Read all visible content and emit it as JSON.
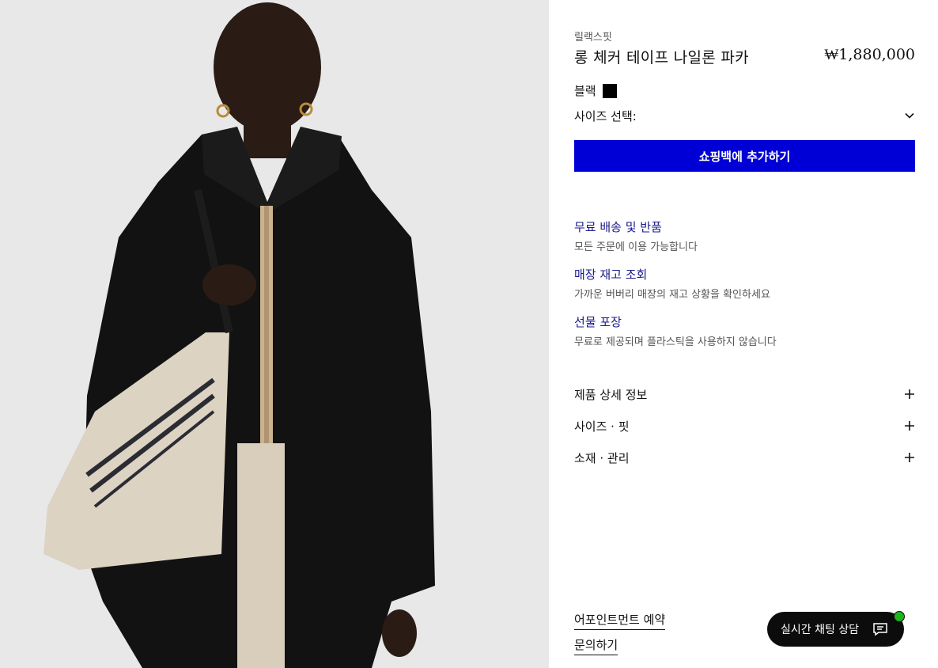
{
  "product": {
    "fit": "릴랙스핏",
    "title": "롱 체커 테이프 나일론 파카",
    "price": "₩1,880,000",
    "color_label": "블랙",
    "color_swatch": "#000000",
    "size_label": "사이즈 선택:",
    "add_to_bag": "쇼핑백에 추가하기",
    "accent_color": "#0000d6"
  },
  "services": [
    {
      "title": "무료 배송 및 반품",
      "desc": "모든 주문에 이용 가능합니다"
    },
    {
      "title": "매장 재고 조회",
      "desc": "가까운 버버리 매장의 재고 상황을 확인하세요"
    },
    {
      "title": "선물 포장",
      "desc": "무료로 제공되며 플라스틱을 사용하지 않습니다"
    }
  ],
  "accordion": [
    {
      "label": "제품 상세 정보",
      "icon": "plus-icon"
    },
    {
      "label": "사이즈 · 핏",
      "icon": "plus-icon"
    },
    {
      "label": "소재 · 관리",
      "icon": "plus-icon"
    }
  ],
  "links": {
    "appointment": "어포인트먼트 예약",
    "contact": "문의하기"
  },
  "chat": {
    "label": "실시간 채팅 상담",
    "icon": "chat-icon",
    "status_color": "#1db41d"
  }
}
